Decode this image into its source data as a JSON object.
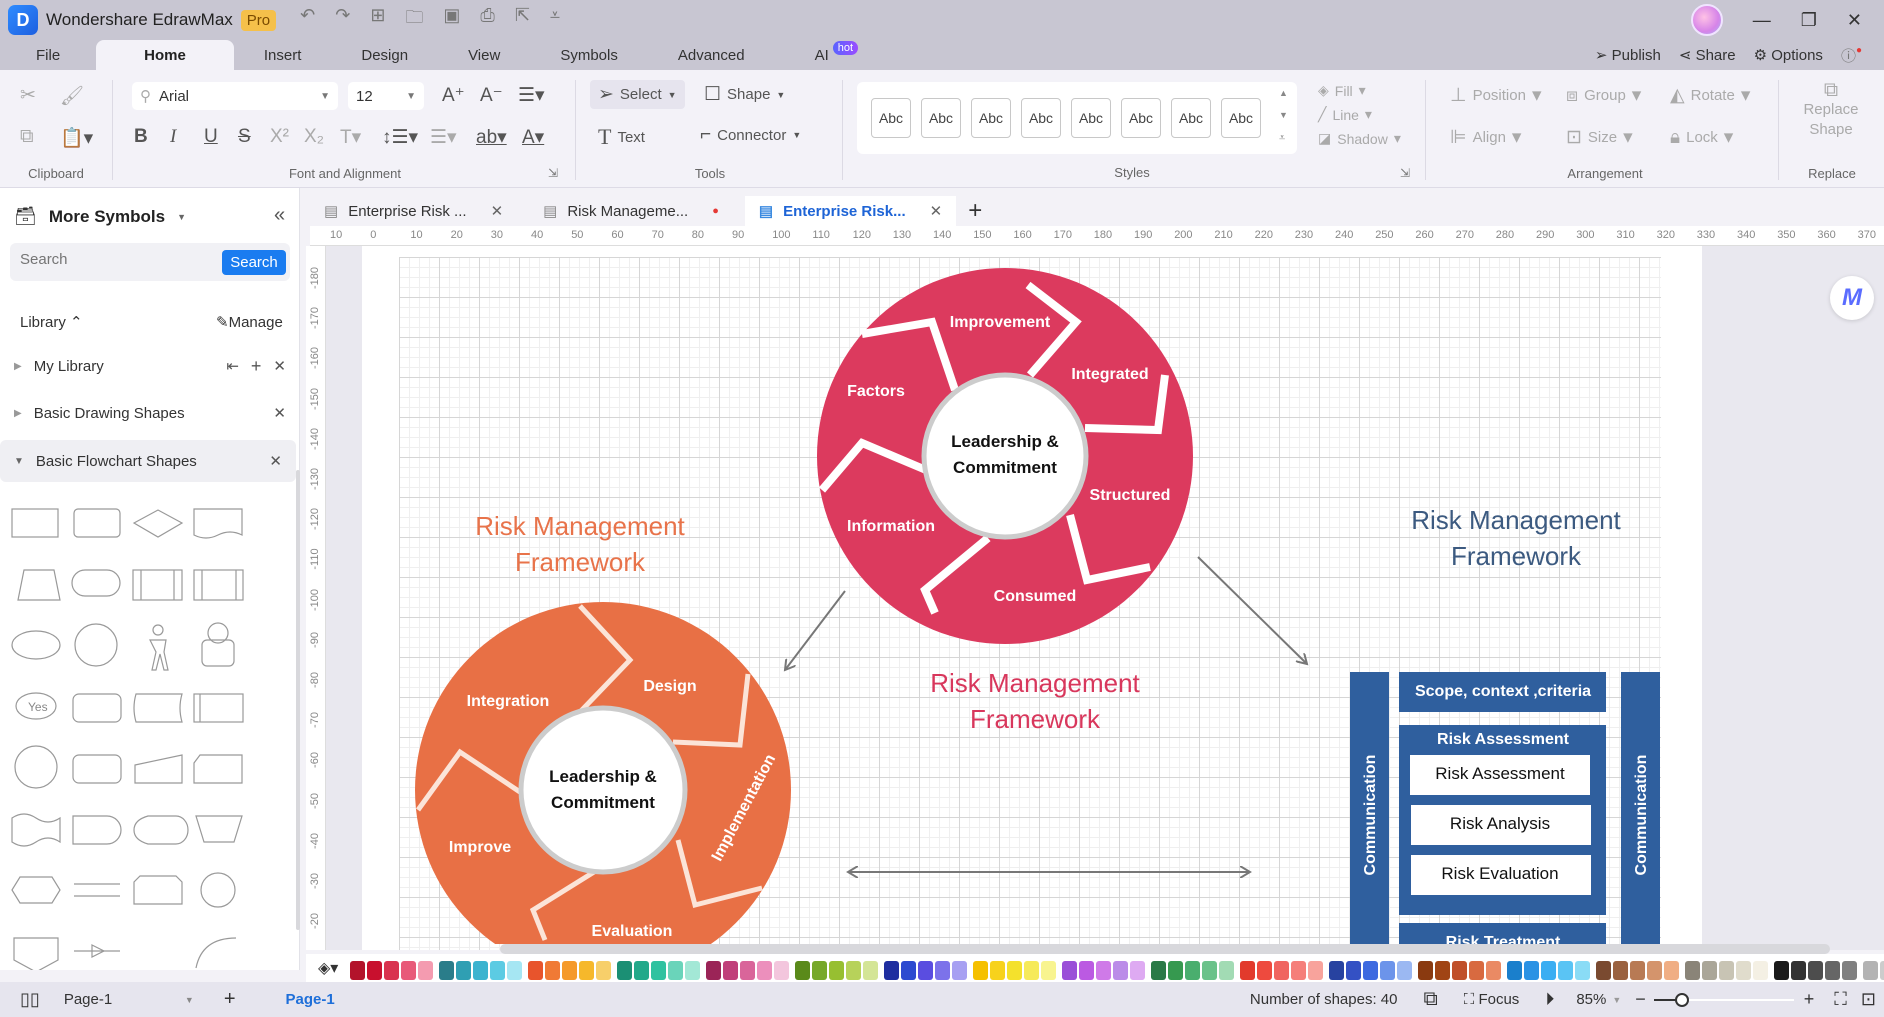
{
  "app": {
    "title": "Wondershare EdrawMax",
    "badge": "Pro"
  },
  "menu": {
    "items": [
      "File",
      "Home",
      "Insert",
      "Design",
      "View",
      "Symbols",
      "Advanced",
      "AI"
    ],
    "active": "Home",
    "ai_badge": "hot",
    "right": {
      "publish": "Publish",
      "share": "Share",
      "options": "Options"
    }
  },
  "ribbon": {
    "clipboard_label": "Clipboard",
    "font": {
      "family": "Arial",
      "size": "12",
      "group_label": "Font and Alignment"
    },
    "tools": {
      "select": "Select",
      "shape": "Shape",
      "text": "Text",
      "connector": "Connector",
      "group_label": "Tools"
    },
    "styles": {
      "items": [
        "Abc",
        "Abc",
        "Abc",
        "Abc",
        "Abc",
        "Abc",
        "Abc",
        "Abc"
      ],
      "group_label": "Styles"
    },
    "format": {
      "fill": "Fill",
      "line": "Line",
      "shadow": "Shadow"
    },
    "arrangement": {
      "position": "Position",
      "group": "Group",
      "rotate": "Rotate",
      "align": "Align",
      "size": "Size",
      "lock": "Lock",
      "group_label": "Arrangement"
    },
    "replace": {
      "button_line1": "Replace",
      "button_line2": "Shape",
      "group_label": "Replace"
    }
  },
  "sidebar": {
    "title": "More Symbols",
    "search_placeholder": "Search",
    "search_button": "Search",
    "library_label": "Library",
    "manage_label": "Manage",
    "libraries": [
      {
        "name": "My Library",
        "expanded": false
      },
      {
        "name": "Basic Drawing Shapes",
        "expanded": false
      },
      {
        "name": "Basic Flowchart Shapes",
        "expanded": true
      }
    ],
    "yes_shape_label": "Yes"
  },
  "doc_tabs": [
    {
      "label": "Enterprise Risk ...",
      "state": "close"
    },
    {
      "label": "Risk Manageme...",
      "state": "unsaved"
    },
    {
      "label": "Enterprise Risk...",
      "state": "active"
    }
  ],
  "rulers": {
    "horizontal": [
      "10",
      "0",
      "10",
      "20",
      "30",
      "40",
      "50",
      "60",
      "70",
      "80",
      "90",
      "100",
      "110",
      "120",
      "130",
      "140",
      "150",
      "160",
      "170",
      "180",
      "190",
      "200",
      "210",
      "220",
      "230",
      "240",
      "250",
      "260",
      "270",
      "280",
      "290",
      "300",
      "310",
      "320",
      "330",
      "340",
      "350",
      "360",
      "370"
    ],
    "vertical": [
      "-180",
      "-170",
      "-160",
      "-150",
      "-140",
      "-130",
      "-120",
      "-110",
      "-100",
      "-90",
      "-80",
      "-70",
      "-60",
      "-50",
      "-40",
      "-30",
      "-20"
    ]
  },
  "canvas": {
    "title_orange": {
      "line1": "Risk Management",
      "line2": "Framework",
      "color": "#e8734a"
    },
    "title_red": {
      "line1": "Risk Management",
      "line2": "Framework",
      "color": "#d8375c"
    },
    "title_blue": {
      "line1": "Risk Management",
      "line2": "Framework",
      "color": "#3c5a80"
    },
    "red_wheel": {
      "color": "#dc3a5e",
      "center_line1": "Leadership &",
      "center_line2": "Commitment",
      "segments": [
        "Improvement",
        "Integrated",
        "Structured",
        "Consumed",
        "Information",
        "Factors"
      ]
    },
    "orange_wheel": {
      "color": "#e87045",
      "center_line1": "Leadership &",
      "center_line2": "Commitment",
      "segments": [
        "Design",
        "Implementation",
        "Evaluation",
        "Improve",
        "Integration"
      ]
    },
    "blue_diagram": {
      "color": "#2f5f9e",
      "left_bar": "Communication",
      "right_bar": "Communication",
      "top_box": "Scope, context ,criteria",
      "assessment_header": "Risk Assessment",
      "assessment_items": [
        "Risk Assessment",
        "Risk Analysis",
        "Risk Evaluation"
      ],
      "bottom_box": "Risk Treatment"
    }
  },
  "palette": [
    "#b3132b",
    "#c8102e",
    "#d9334f",
    "#e85a79",
    "#f49bb0",
    "#2a7d8a",
    "#2f9fb3",
    "#3bb3cf",
    "#5ccbe3",
    "#a6e6f3",
    "#e8542c",
    "#f07a35",
    "#f59a2a",
    "#f6b82b",
    "#f7cf6a",
    "#1b8f74",
    "#22a98a",
    "#2fc2a0",
    "#6ad4ba",
    "#a3e8d6",
    "#9b2457",
    "#c0407a",
    "#d9659a",
    "#ec8fbc",
    "#f3c6dd",
    "#5a8a1a",
    "#77a82a",
    "#97bf31",
    "#b7d25a",
    "#d4e596",
    "#1f2ea0",
    "#2d4ad0",
    "#5a4de0",
    "#7c72ea",
    "#a7a0f2",
    "#f5c000",
    "#f7d21c",
    "#f4e12c",
    "#f6ea5a",
    "#f8f48f",
    "#9a4fd8",
    "#bb5ae2",
    "#cf7ae8",
    "#bb8ce8",
    "#deaaf2",
    "#2a7a46",
    "#36994f",
    "#4aae6e",
    "#6bc28a",
    "#a2dbb4",
    "#e23a2c",
    "#ee4a3e",
    "#f06560",
    "#f57f7a",
    "#f8a39c",
    "#2742a0",
    "#3451c4",
    "#3e6ae0",
    "#6c94ea",
    "#9bb8f2",
    "#8a3a10",
    "#a04414",
    "#c0502a",
    "#d86a40",
    "#ea8a64",
    "#1a7fcc",
    "#2a92e4",
    "#3aaef2",
    "#5ac4f4",
    "#8adcf6",
    "#7a4a30",
    "#9a6240",
    "#b87a54",
    "#d4946c",
    "#f0ae84",
    "#8a8478",
    "#aaa698",
    "#c8c4b4",
    "#e0dccc",
    "#f4f0e4",
    "#1a1a1a",
    "#333333",
    "#4d4d4d",
    "#666666",
    "#808080",
    "#b3b3b3",
    "#cccccc",
    "#e0e0e0",
    "#f0f0f0"
  ],
  "statusbar": {
    "page_select": "Page-1",
    "page_tab": "Page-1",
    "shapes_count": "Number of shapes: 40",
    "focus": "Focus",
    "zoom": "85%",
    "zoom_fraction": 0.2
  }
}
